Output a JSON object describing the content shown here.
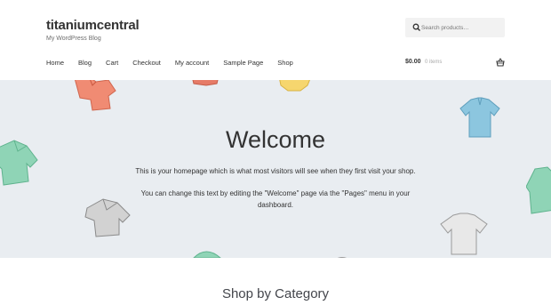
{
  "site": {
    "title": "titaniumcentral",
    "tagline": "My WordPress Blog"
  },
  "search": {
    "placeholder": "Search products…",
    "icon": "search-icon"
  },
  "nav": {
    "items": [
      "Home",
      "Blog",
      "Cart",
      "Checkout",
      "My account",
      "Sample Page",
      "Shop"
    ]
  },
  "cart": {
    "amount": "$0.00",
    "count": "0 items",
    "icon": "basket-icon"
  },
  "hero": {
    "title": "Welcome",
    "line1": "This is your homepage which is what most visitors will see when they first visit your shop.",
    "line2": "You can change this text by editing the \"Welcome\" page via the \"Pages\" menu in your dashboard.",
    "background": "#e9edf1"
  },
  "section": {
    "title": "Shop by Category"
  },
  "colors": {
    "hoodie_coral": "#f08b73",
    "hoodie_mint": "#8fd4b6",
    "polo_blue": "#8cc6df",
    "tshirt_grey": "#d9d9d9",
    "jacket_grey": "#9a9a9a",
    "top_yellow": "#f6d66e",
    "top_red": "#e67b67"
  }
}
